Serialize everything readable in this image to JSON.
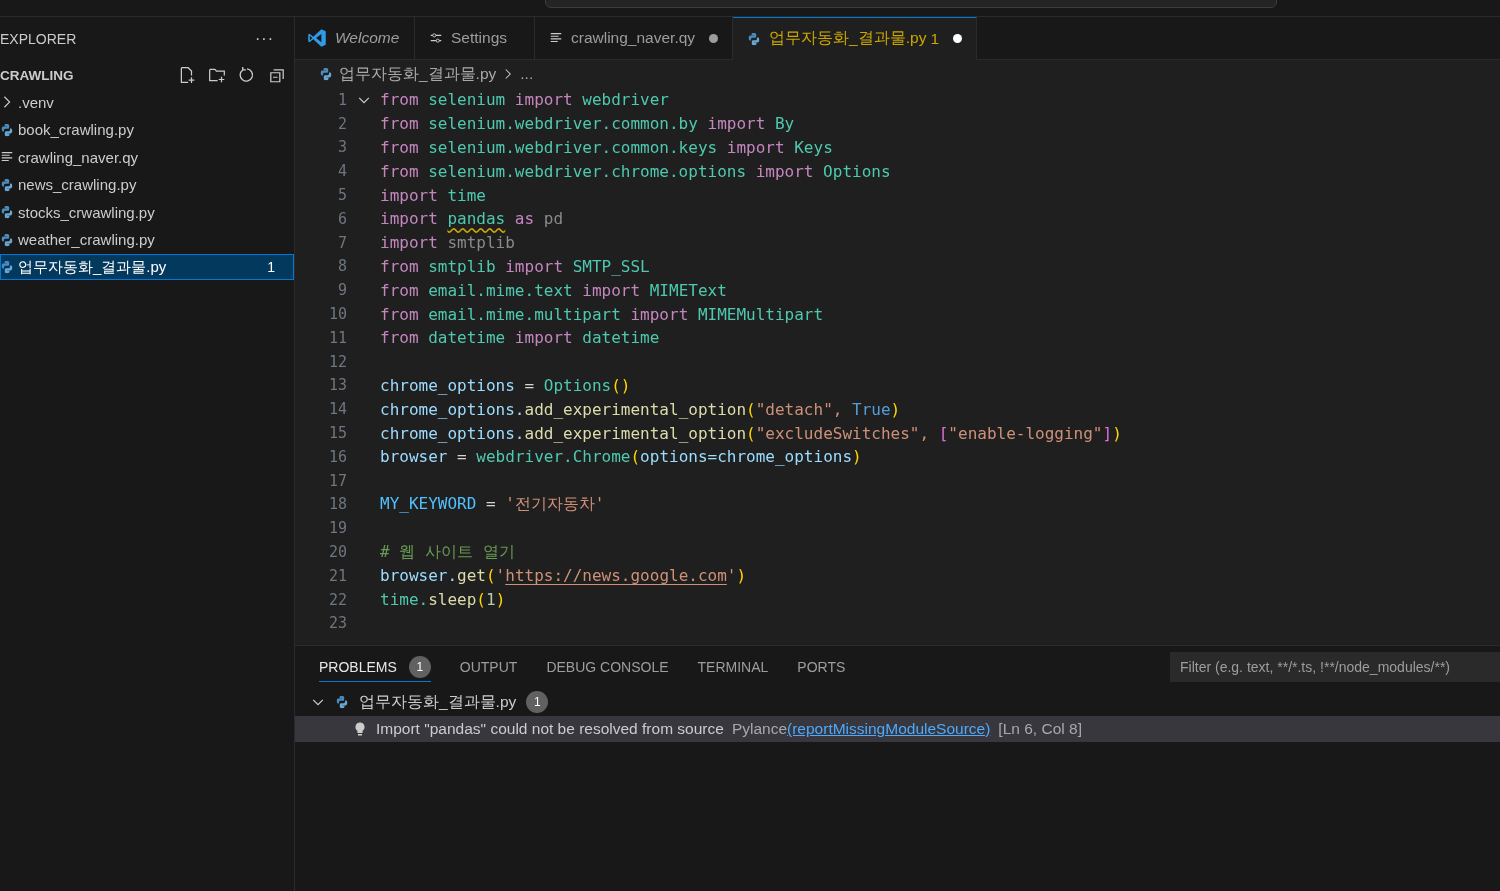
{
  "sidebar": {
    "title": "EXPLORER",
    "more": "···",
    "folder": "CRAWLING",
    "items": [
      {
        "label": ".venv",
        "kind": "folder",
        "selected": false
      },
      {
        "label": "book_crawling.py",
        "kind": "python",
        "selected": false
      },
      {
        "label": "crawling_naver.qy",
        "kind": "text",
        "selected": false
      },
      {
        "label": "news_crawling.py",
        "kind": "python",
        "selected": false
      },
      {
        "label": "stocks_crwawling.py",
        "kind": "python",
        "selected": false
      },
      {
        "label": "weather_crawling.py",
        "kind": "python",
        "selected": false
      },
      {
        "label": "업무자동화_결과물.py",
        "kind": "python",
        "selected": true,
        "badge": "1"
      }
    ]
  },
  "tabs": [
    {
      "label": "Welcome",
      "kind": "welcome",
      "selected": false,
      "preview": true,
      "dirty": false,
      "warning": false
    },
    {
      "label": "Settings",
      "kind": "settings",
      "selected": false,
      "preview": false,
      "dirty": false,
      "warning": false
    },
    {
      "label": "crawling_naver.qy",
      "kind": "text",
      "selected": false,
      "preview": false,
      "dirty": true,
      "warning": false
    },
    {
      "label": "업무자동화_결과물.py",
      "kind": "python",
      "selected": true,
      "preview": false,
      "dirty": true,
      "warning": true,
      "problems": "1"
    }
  ],
  "breadcrumb": {
    "file": "업무자동화_결과물.py",
    "rest": "..."
  },
  "code": [
    {
      "number": "1",
      "foldable": true,
      "tokens": [
        {
          "text": "from",
          "kind": "keyword"
        },
        {
          "text": " selenium",
          "kind": "module"
        },
        {
          "text": " import",
          "kind": "keyword"
        },
        {
          "text": " webdriver",
          "kind": "module"
        }
      ]
    },
    {
      "number": "2",
      "foldable": false,
      "tokens": [
        {
          "text": "from",
          "kind": "keyword"
        },
        {
          "text": " selenium.webdriver.common.by",
          "kind": "module"
        },
        {
          "text": " import",
          "kind": "keyword"
        },
        {
          "text": " By",
          "kind": "module"
        }
      ]
    },
    {
      "number": "3",
      "foldable": false,
      "tokens": [
        {
          "text": "from",
          "kind": "keyword"
        },
        {
          "text": " selenium.webdriver.common.keys",
          "kind": "module"
        },
        {
          "text": " import",
          "kind": "keyword"
        },
        {
          "text": " Keys",
          "kind": "module"
        }
      ]
    },
    {
      "number": "4",
      "foldable": false,
      "tokens": [
        {
          "text": "from",
          "kind": "keyword"
        },
        {
          "text": " selenium.webdriver.chrome.options",
          "kind": "module"
        },
        {
          "text": " import",
          "kind": "keyword"
        },
        {
          "text": " Options",
          "kind": "module"
        }
      ]
    },
    {
      "number": "5",
      "foldable": false,
      "tokens": [
        {
          "text": "import",
          "kind": "keyword"
        },
        {
          "text": " time",
          "kind": "module"
        }
      ]
    },
    {
      "number": "6",
      "foldable": false,
      "tokens": [
        {
          "text": "import ",
          "kind": "keyword"
        },
        {
          "text": "pandas",
          "kind": "module",
          "squiggle": true
        },
        {
          "text": " as",
          "kind": "keyword"
        },
        {
          "text": " pd",
          "kind": "unused"
        }
      ]
    },
    {
      "number": "7",
      "foldable": false,
      "tokens": [
        {
          "text": "import",
          "kind": "keyword"
        },
        {
          "text": " smtplib",
          "kind": "unused"
        }
      ]
    },
    {
      "number": "8",
      "foldable": false,
      "tokens": [
        {
          "text": "from",
          "kind": "keyword"
        },
        {
          "text": " smtplib",
          "kind": "module"
        },
        {
          "text": " import",
          "kind": "keyword"
        },
        {
          "text": " SMTP_SSL",
          "kind": "module"
        }
      ]
    },
    {
      "number": "9",
      "foldable": false,
      "tokens": [
        {
          "text": "from",
          "kind": "keyword"
        },
        {
          "text": " email.mime.text",
          "kind": "module"
        },
        {
          "text": " import",
          "kind": "keyword"
        },
        {
          "text": " MIMEText",
          "kind": "module"
        }
      ]
    },
    {
      "number": "10",
      "foldable": false,
      "tokens": [
        {
          "text": "from",
          "kind": "keyword"
        },
        {
          "text": " email.mime.multipart",
          "kind": "module"
        },
        {
          "text": " import",
          "kind": "keyword"
        },
        {
          "text": " MIMEMultipart",
          "kind": "module"
        }
      ]
    },
    {
      "number": "11",
      "foldable": false,
      "tokens": [
        {
          "text": "from",
          "kind": "keyword"
        },
        {
          "text": " datetime",
          "kind": "module"
        },
        {
          "text": " import",
          "kind": "keyword"
        },
        {
          "text": " datetime",
          "kind": "module"
        }
      ]
    },
    {
      "number": "12",
      "foldable": false
    },
    {
      "number": "13",
      "foldable": false,
      "tokens": [
        {
          "text": "chrome_options",
          "kind": "variable"
        },
        {
          "text": " = ",
          "kind": "plain"
        },
        {
          "text": "Options",
          "kind": "module"
        },
        {
          "text": "()",
          "kind": "bracket"
        }
      ]
    },
    {
      "number": "14",
      "foldable": false,
      "tokens": [
        {
          "text": "chrome_options.",
          "kind": "variable"
        },
        {
          "text": "add_experimental_option",
          "kind": "function"
        },
        {
          "text": "(",
          "kind": "bracket"
        },
        {
          "text": "\"detach\",",
          "kind": "string"
        },
        {
          "text": " True",
          "kind": "boolean"
        },
        {
          "text": ")",
          "kind": "bracket"
        }
      ]
    },
    {
      "number": "15",
      "foldable": false,
      "tokens": [
        {
          "text": "chrome_options.",
          "kind": "variable"
        },
        {
          "text": "add_experimental_option",
          "kind": "function"
        },
        {
          "text": "(",
          "kind": "bracket"
        },
        {
          "text": "\"excludeSwitches\",",
          "kind": "string"
        },
        {
          "text": " [",
          "kind": "bracket2"
        },
        {
          "text": "\"enable-logging\"",
          "kind": "string"
        },
        {
          "text": "]",
          "kind": "bracket2"
        },
        {
          "text": ")",
          "kind": "bracket"
        }
      ]
    },
    {
      "number": "16",
      "foldable": false,
      "tokens": [
        {
          "text": "browser",
          "kind": "variable"
        },
        {
          "text": " = ",
          "kind": "plain"
        },
        {
          "text": "webdriver.Chrome",
          "kind": "module"
        },
        {
          "text": "(",
          "kind": "bracket"
        },
        {
          "text": "options=chrome_options",
          "kind": "variable"
        },
        {
          "text": ")",
          "kind": "bracket"
        }
      ]
    },
    {
      "number": "17",
      "foldable": false
    },
    {
      "number": "18",
      "foldable": false,
      "tokens": [
        {
          "text": "MY_KEYWORD",
          "kind": "constant"
        },
        {
          "text": " = ",
          "kind": "plain"
        },
        {
          "text": "'전기자동차'",
          "kind": "string"
        }
      ]
    },
    {
      "number": "19",
      "foldable": false
    },
    {
      "number": "20",
      "foldable": false,
      "tokens": [
        {
          "text": "# 웹 사이트 열기",
          "kind": "comment"
        }
      ]
    },
    {
      "number": "21",
      "foldable": false,
      "tokens": [
        {
          "text": "browser.",
          "kind": "variable"
        },
        {
          "text": "get",
          "kind": "function"
        },
        {
          "text": "(",
          "kind": "bracket"
        },
        {
          "text": "'",
          "kind": "string"
        },
        {
          "text": "https://news.google.com",
          "kind": "link"
        },
        {
          "text": "'",
          "kind": "string"
        },
        {
          "text": ")",
          "kind": "bracket"
        }
      ]
    },
    {
      "number": "22",
      "foldable": false,
      "tokens": [
        {
          "text": "time.",
          "kind": "module"
        },
        {
          "text": "sleep",
          "kind": "function"
        },
        {
          "text": "(",
          "kind": "bracket"
        },
        {
          "text": "1",
          "kind": "number"
        },
        {
          "text": ")",
          "kind": "bracket"
        }
      ]
    },
    {
      "number": "23",
      "foldable": false
    }
  ],
  "panel": {
    "tabs": [
      {
        "label": "PROBLEMS",
        "selected": true,
        "badge": "1"
      },
      {
        "label": "OUTPUT",
        "selected": false
      },
      {
        "label": "DEBUG CONSOLE",
        "selected": false
      },
      {
        "label": "TERMINAL",
        "selected": false
      },
      {
        "label": "PORTS",
        "selected": false
      }
    ],
    "filter": {
      "placeholder": "Filter (e.g. text, **/*.ts, !**/node_modules/**)"
    },
    "files": [
      {
        "name": "업무자동화_결과물.py",
        "expanded": true,
        "badge": "1",
        "problems": [
          {
            "message": "Import \"pandas\" could not be resolved from source",
            "source": "Pylance",
            "code": "(reportMissingModuleSource)",
            "location": "[Ln 6, Col 8]",
            "selected": true
          }
        ]
      }
    ]
  }
}
